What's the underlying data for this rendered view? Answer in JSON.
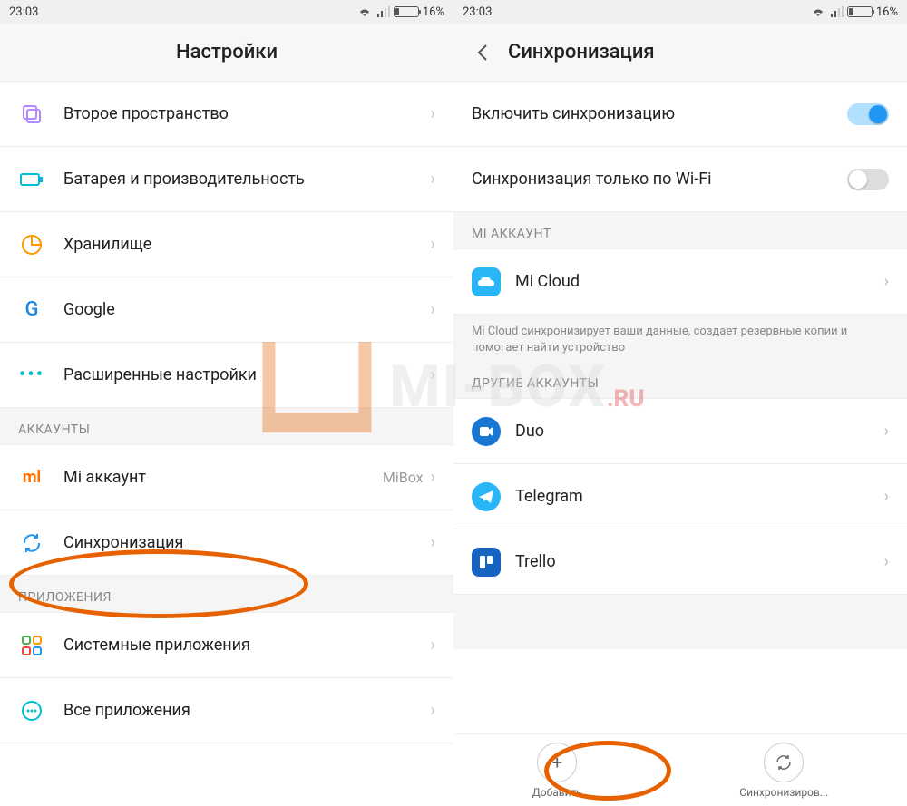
{
  "status": {
    "time": "23:03",
    "battery": "16%"
  },
  "left": {
    "header": "Настройки",
    "items": [
      {
        "id": "second-space",
        "label": "Второе пространство",
        "iconColor": "#b388ff"
      },
      {
        "id": "battery",
        "label": "Батарея и производительность",
        "iconColor": "#00bcd4"
      },
      {
        "id": "storage",
        "label": "Хранилище",
        "iconColor": "#ff9800"
      },
      {
        "id": "google",
        "label": "Google",
        "iconColor": "#1e88e5"
      },
      {
        "id": "advanced",
        "label": "Расширенные настройки",
        "iconColor": "#00bcd4"
      }
    ],
    "section_accounts": "АККАУНТЫ",
    "accounts": [
      {
        "id": "mi-account",
        "label": "Mi аккаунт",
        "value": "MiBox",
        "iconColor": "#ff6f00"
      },
      {
        "id": "sync",
        "label": "Синхронизация",
        "iconColor": "#2196f3"
      }
    ],
    "section_apps": "ПРИЛОЖЕНИЯ",
    "apps": [
      {
        "id": "system-apps",
        "label": "Системные приложения",
        "iconColor": "#4caf50"
      },
      {
        "id": "all-apps",
        "label": "Все приложения",
        "iconColor": "#00bcd4"
      }
    ]
  },
  "right": {
    "header": "Синхронизация",
    "toggles": [
      {
        "id": "enable-sync",
        "label": "Включить синхронизацию",
        "on": true
      },
      {
        "id": "wifi-only",
        "label": "Синхронизация только по Wi-Fi",
        "on": false
      }
    ],
    "section_mi": "MI АККАУНТ",
    "mi_item": {
      "label": "Mi Cloud",
      "iconBg": "#29b6f6"
    },
    "mi_note": "Mi Cloud синхронизирует ваши данные, создает резервные копии и помогает найти устройство",
    "section_other": "ДРУГИЕ АККАУНТЫ",
    "other": [
      {
        "id": "duo",
        "label": "Duo",
        "iconBg": "#1976d2"
      },
      {
        "id": "telegram",
        "label": "Telegram",
        "iconBg": "#29b6f6"
      },
      {
        "id": "trello",
        "label": "Trello",
        "iconBg": "#1565c0"
      }
    ],
    "bottom": {
      "add": "Добавить",
      "sync": "Синхронизиров..."
    }
  },
  "watermark": {
    "text": "MI-BOX",
    "suffix": ".RU"
  }
}
